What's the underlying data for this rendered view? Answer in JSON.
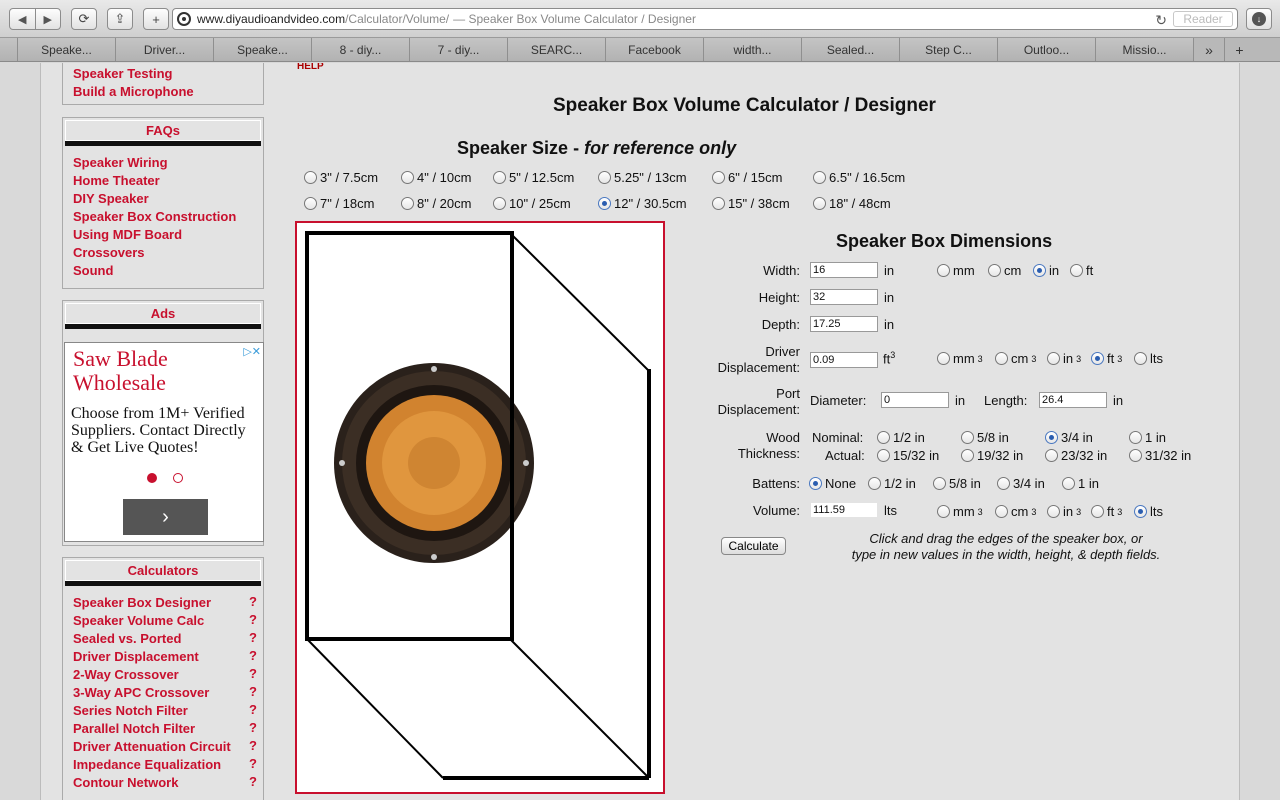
{
  "browser": {
    "url_host": "www.diyaudioandvideo.com",
    "url_path": "/Calculator/Volume/",
    "page_title": "— Speaker Box Volume Calculator / Designer",
    "reader_label": "Reader",
    "tabs": [
      "Speake...",
      "Driver...",
      "Speake...",
      "8 - diy...",
      "7 - diy...",
      "SEARC...",
      "Facebook",
      "width...",
      "Sealed...",
      "Step C...",
      "Outloo...",
      "Missio..."
    ]
  },
  "sidebar": {
    "top_links": [
      "Speaker Testing",
      "Build a Microphone"
    ],
    "faqs": {
      "title": "FAQs",
      "links": [
        "Speaker Wiring",
        "Home Theater",
        "DIY Speaker",
        "Speaker Box Construction",
        "Using MDF Board",
        "Crossovers",
        "Sound"
      ]
    },
    "ads": {
      "title": "Ads",
      "ad_title": "Saw Blade Wholesale",
      "ad_text": "Choose from 1M+ Verified Suppliers. Contact Directly & Get Live Quotes!"
    },
    "calculators": {
      "title": "Calculators",
      "links": [
        "Speaker Box Designer",
        "Speaker Volume Calc",
        "Sealed vs. Ported",
        "Driver Displacement",
        "2-Way Crossover",
        "3-Way APC Crossover",
        "Series Notch Filter",
        "Parallel Notch Filter",
        "Driver Attenuation Circuit",
        "Impedance Equalization",
        "Contour Network"
      ],
      "help_mark": "?"
    }
  },
  "main": {
    "help": "HELP",
    "title": "Speaker Box Volume Calculator / Designer",
    "size_title_bold": "Speaker Size - ",
    "size_title_italic": "for reference only",
    "sizes": [
      "3\" / 7.5cm",
      "4\" / 10cm",
      "5\" / 12.5cm",
      "5.25\" / 13cm",
      "6\" / 15cm",
      "6.5\" / 16.5cm",
      "7\" / 18cm",
      "8\" / 20cm",
      "10\" / 25cm",
      "12\" / 30.5cm",
      "15\" / 38cm",
      "18\" / 48cm"
    ],
    "selected_size": "12\" / 30.5cm"
  },
  "dims": {
    "title": "Speaker Box Dimensions",
    "width_label": "Width:",
    "width": "16",
    "height_label": "Height:",
    "height": "32",
    "depth_label": "Depth:",
    "depth": "17.25",
    "unit_in": "in",
    "length_units": [
      "mm",
      "cm",
      "in",
      "ft"
    ],
    "length_selected": "in",
    "driver_label_1": "Driver",
    "driver_label_2": "Displacement:",
    "driver": "0.09",
    "driver_unit": "ft",
    "vol_units": [
      "mm",
      "cm",
      "in",
      "ft",
      "lts"
    ],
    "driver_unit_selected": "ft",
    "port_label_1": "Port",
    "port_label_2": "Displacement:",
    "diameter_label": "Diameter:",
    "diameter": "0",
    "length_label": "Length:",
    "length": "26.4",
    "wood_label_1": "Wood",
    "wood_label_2": "Thickness:",
    "nominal_label": "Nominal:",
    "actual_label": "Actual:",
    "nominal": [
      "1/2 in",
      "5/8 in",
      "3/4 in",
      "1 in"
    ],
    "actual": [
      "15/32 in",
      "19/32 in",
      "23/32 in",
      "31/32 in"
    ],
    "wood_selected": "3/4 in",
    "battens_label": "Battens:",
    "battens": [
      "None",
      "1/2 in",
      "5/8 in",
      "3/4 in",
      "1 in"
    ],
    "battens_selected": "None",
    "volume_label": "Volume:",
    "volume": "111.59",
    "volume_unit": "lts",
    "volume_unit_selected": "lts",
    "calculate": "Calculate",
    "hint_1": "Click and drag the edges of the speaker box, or",
    "hint_2": "type in new values in the width, height, & depth fields."
  }
}
